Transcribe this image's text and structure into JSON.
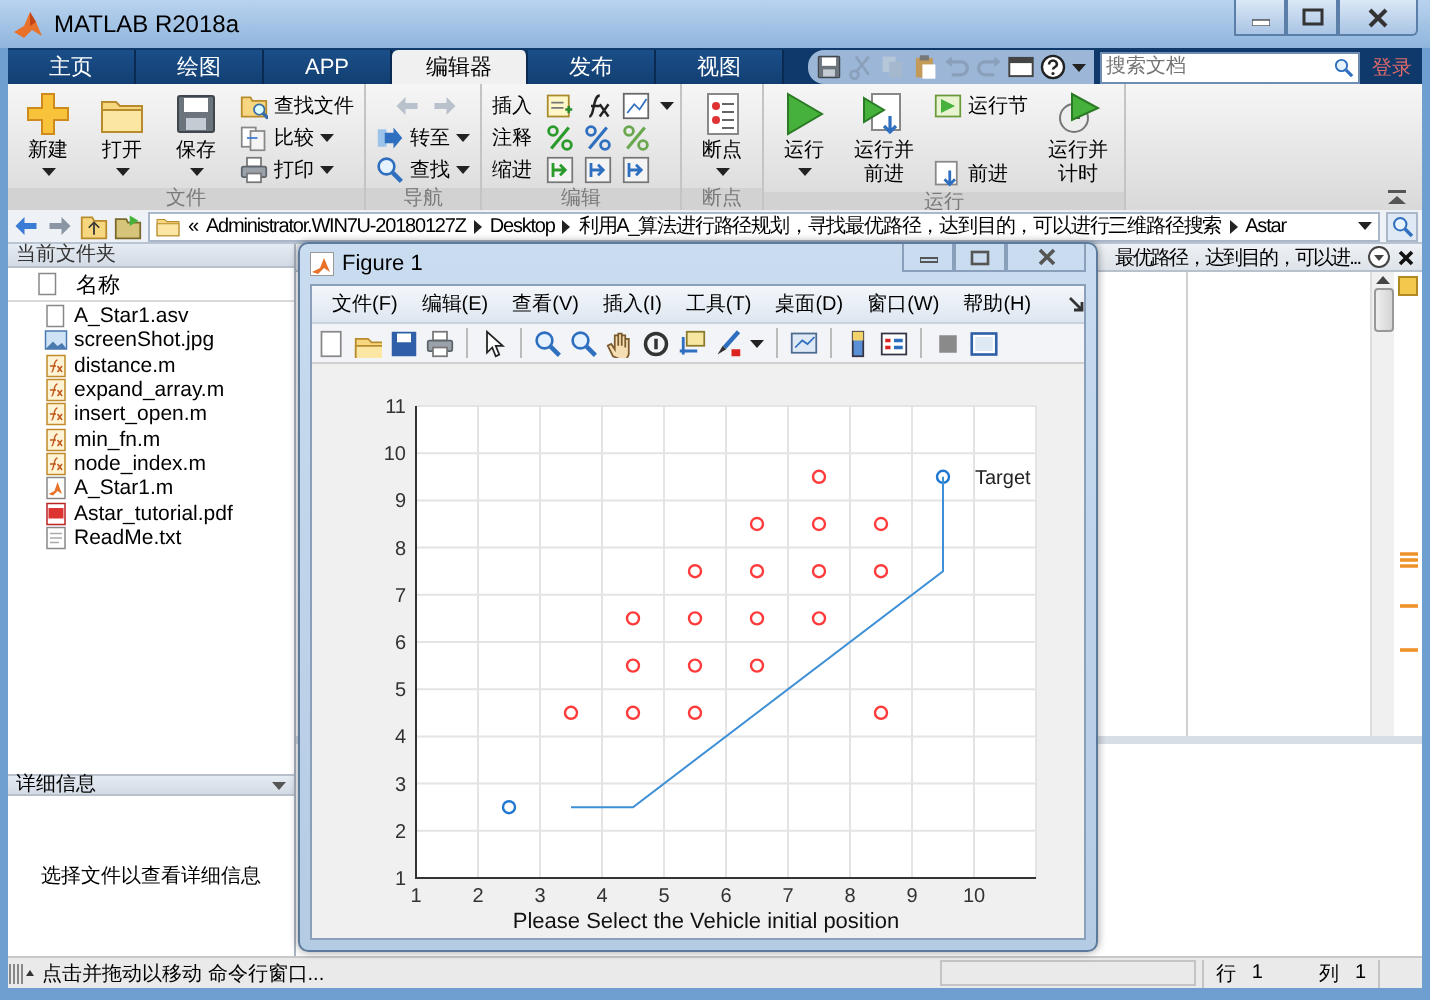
{
  "window": {
    "title": "MATLAB R2018a"
  },
  "tabs": [
    {
      "label": "主页",
      "selected": false
    },
    {
      "label": "绘图",
      "selected": false
    },
    {
      "label": "APP",
      "selected": false
    },
    {
      "label": "编辑器",
      "selected": true
    },
    {
      "label": "发布",
      "selected": false
    },
    {
      "label": "视图",
      "selected": false
    }
  ],
  "search": {
    "placeholder": "搜索文档"
  },
  "login": "登录",
  "ribbon": {
    "sections": [
      {
        "title": "文件",
        "items": [
          {
            "kind": "large",
            "label": "新建",
            "dropdown": true
          },
          {
            "kind": "large",
            "label": "打开",
            "dropdown": true
          },
          {
            "kind": "large",
            "label": "保存",
            "dropdown": true
          },
          {
            "kind": "small",
            "label": "查找文件",
            "dropdown": false
          },
          {
            "kind": "small",
            "label": "比较",
            "dropdown": true
          },
          {
            "kind": "small",
            "label": "打印",
            "dropdown": true
          }
        ]
      },
      {
        "title": "导航",
        "items": [
          {
            "kind": "arrows",
            "disabled": true
          },
          {
            "kind": "small",
            "label": "转至",
            "dropdown": true
          },
          {
            "kind": "small",
            "label": "查找",
            "dropdown": true
          }
        ]
      },
      {
        "title": "编辑",
        "items": [
          {
            "kind": "row",
            "label": "插入",
            "dropdown": true
          },
          {
            "kind": "row",
            "label": "注释",
            "dropdown": false
          },
          {
            "kind": "row",
            "label": "缩进",
            "dropdown": false
          }
        ]
      },
      {
        "title": "断点",
        "items": [
          {
            "kind": "large",
            "label": "断点",
            "dropdown": true
          }
        ]
      },
      {
        "title": "运行",
        "items": [
          {
            "kind": "large",
            "label": "运行",
            "dropdown": true
          },
          {
            "kind": "large",
            "label": "运行并前进",
            "dropdown": false
          },
          {
            "kind": "small",
            "label": "运行节",
            "dropdown": false
          },
          {
            "kind": "small",
            "label": "前进",
            "dropdown": false
          },
          {
            "kind": "large",
            "label": "运行并计时",
            "dropdown": false
          }
        ]
      }
    ]
  },
  "address": {
    "overflow_mark": "«",
    "segments": [
      "Administrator.WIN7U-20180127Z",
      "Desktop",
      "利用A_算法进行路径规划，寻找最优路径，达到目的，可以进行三维路径搜索",
      "Astar"
    ]
  },
  "current_folder": {
    "title": "当前文件夹",
    "column": "名称",
    "files": [
      {
        "name": "A_Star1.asv",
        "kind": "asv"
      },
      {
        "name": "screenShot.jpg",
        "kind": "image"
      },
      {
        "name": "distance.m",
        "kind": "function"
      },
      {
        "name": "expand_array.m",
        "kind": "function"
      },
      {
        "name": "insert_open.m",
        "kind": "function"
      },
      {
        "name": "min_fn.m",
        "kind": "function"
      },
      {
        "name": "node_index.m",
        "kind": "function"
      },
      {
        "name": "A_Star1.m",
        "kind": "script"
      },
      {
        "name": "Astar_tutorial.pdf",
        "kind": "pdf"
      },
      {
        "name": "ReadMe.txt",
        "kind": "text"
      }
    ],
    "details_title": "详细信息",
    "details_hint": "选择文件以查看详细信息"
  },
  "editor": {
    "tab_title": "最优路径，达到目的，可以进..."
  },
  "figure": {
    "title": "Figure 1",
    "menus": [
      "文件(F)",
      "编辑(E)",
      "查看(V)",
      "插入(I)",
      "工具(T)",
      "桌面(D)",
      "窗口(W)",
      "帮助(H)"
    ],
    "chart_data": {
      "type": "scatter",
      "xlabel": "Please Select the Vehicle initial position",
      "xlim": [
        1,
        11
      ],
      "ylim": [
        1,
        11
      ],
      "grid": true,
      "xticks": [
        1,
        2,
        3,
        4,
        5,
        6,
        7,
        8,
        9,
        10
      ],
      "yticks": [
        1,
        2,
        3,
        4,
        5,
        6,
        7,
        8,
        9,
        10,
        11
      ],
      "series": [
        {
          "color": "#ff3b3b",
          "x": [
            7.5,
            6.5,
            7.5,
            8.5,
            5.5,
            6.5,
            7.5,
            8.5,
            4.5,
            5.5,
            6.5,
            7.5,
            4.5,
            5.5,
            6.5,
            3.5,
            4.5,
            5.5,
            8.5
          ],
          "values": [
            9.5,
            8.5,
            8.5,
            8.5,
            7.5,
            7.5,
            7.5,
            7.5,
            6.5,
            6.5,
            6.5,
            6.5,
            5.5,
            5.5,
            5.5,
            4.5,
            4.5,
            4.5,
            4.5
          ]
        },
        {
          "color": "#1f77d0",
          "x": [
            2.5
          ],
          "values": [
            2.5
          ]
        },
        {
          "color": "#1f77d0",
          "x": [
            9.5
          ],
          "values": [
            9.5
          ]
        },
        {
          "type": "line",
          "color": "#3d8fd6",
          "x": [
            3.5,
            4.5,
            9.5,
            9.5
          ],
          "values": [
            2.5,
            2.5,
            7.5,
            9.5
          ]
        }
      ],
      "annotations": [
        "Target"
      ]
    }
  },
  "status_bar": {
    "message": "点击并拖动以移动 命令行窗口...",
    "row_label": "行",
    "row": "1",
    "col_label": "列",
    "col": "1"
  }
}
